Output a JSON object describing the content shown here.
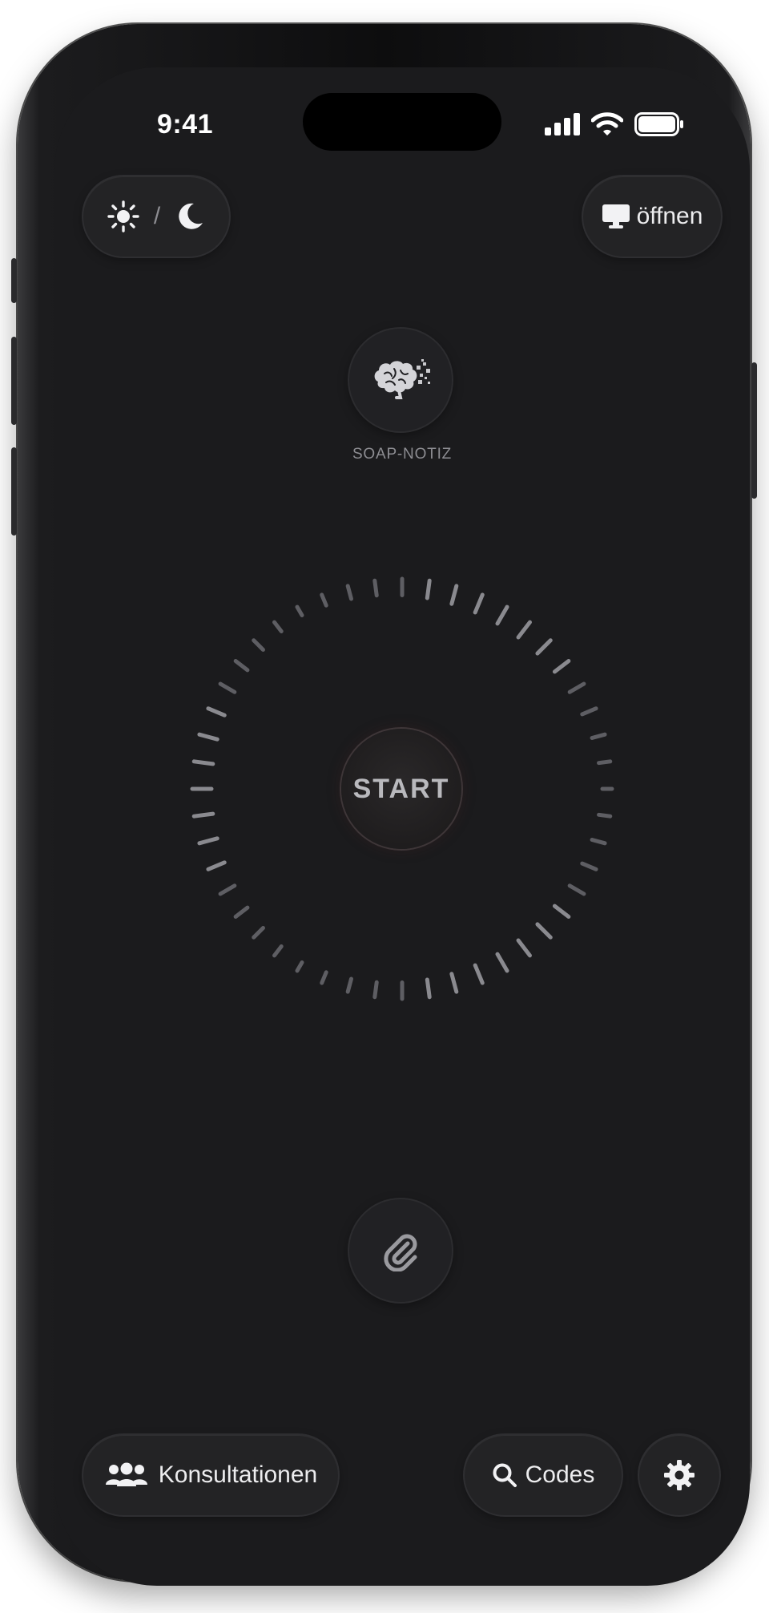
{
  "status_bar": {
    "time": "9:41"
  },
  "top_bar": {
    "theme_toggle": {
      "separator": "/",
      "sun_icon": "sun-icon",
      "moon_icon": "moon-icon"
    },
    "open_button": {
      "label": "öffnen",
      "icon": "monitor-icon"
    }
  },
  "soap": {
    "label": "SOAP-NOTIZ",
    "icon": "brain-icon"
  },
  "recorder": {
    "start_label": "START"
  },
  "attach": {
    "icon": "paperclip-icon"
  },
  "bottom_bar": {
    "consultations": {
      "label": "Konsultationen",
      "icon": "users-icon"
    },
    "codes": {
      "label": "Codes",
      "icon": "search-icon"
    },
    "settings": {
      "icon": "gear-icon"
    }
  },
  "colors": {
    "background": "#1b1b1d",
    "button": "#232325",
    "text": "#ececee",
    "accent_start": "#3e3638"
  }
}
